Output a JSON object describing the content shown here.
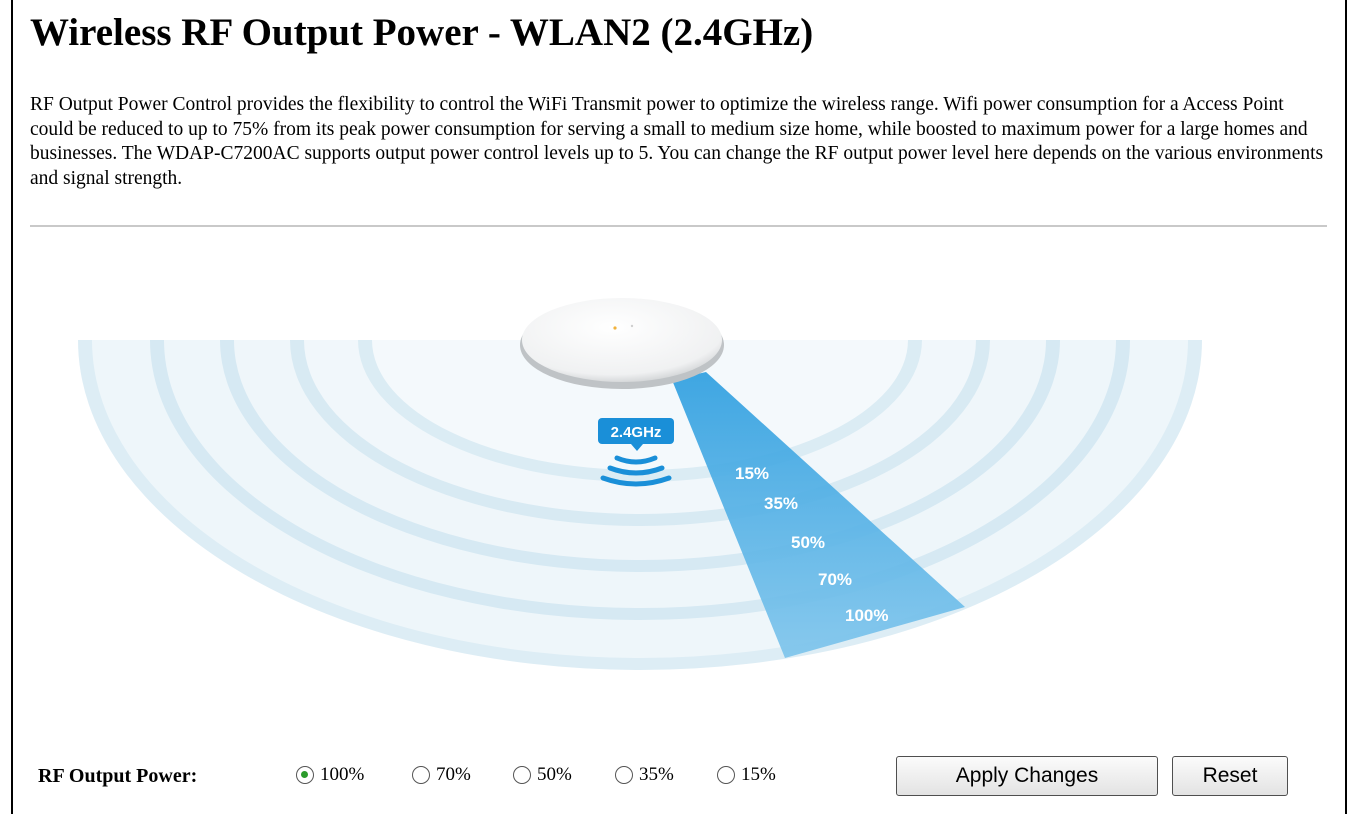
{
  "page": {
    "title": "Wireless RF Output Power - WLAN2 (2.4GHz)",
    "description": "RF Output Power Control provides the flexibility to control the WiFi Transmit power to optimize the wireless range. Wifi power consumption for a Access Point could be reduced to up to 75% from its peak power consumption for serving a small to medium size home, while boosted to maximum power for a large homes and businesses. The WDAP-C7200AC supports output power control levels up to 5. You can change the RF output power level here depends on the various environments and signal strength."
  },
  "diagram": {
    "band_badge": "2.4GHz",
    "levels": [
      "15%",
      "35%",
      "50%",
      "70%",
      "100%"
    ],
    "colors": {
      "ring_light": "#dcedf6",
      "ring_dark": "#b9dbeb",
      "beam": "#3aa5e3",
      "badge": "#1a8fd8"
    }
  },
  "controls": {
    "label": "RF Output Power:",
    "options": [
      {
        "label": "100%",
        "selected": true
      },
      {
        "label": "70%",
        "selected": false
      },
      {
        "label": "50%",
        "selected": false
      },
      {
        "label": "35%",
        "selected": false
      },
      {
        "label": "15%",
        "selected": false
      }
    ],
    "apply_label": "Apply Changes",
    "reset_label": "Reset"
  }
}
